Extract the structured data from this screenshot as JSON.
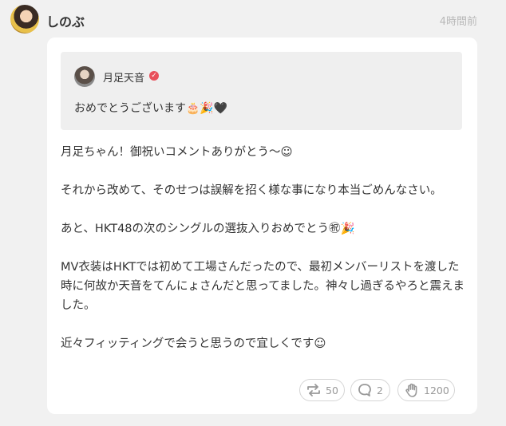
{
  "post": {
    "author": "しのぶ",
    "time": "4時間前",
    "quote": {
      "author": "月足天音",
      "verified_mark": "✓",
      "text": "おめでとうございます🎂🎉🖤"
    },
    "paragraphs": [
      "月足ちゃん！御祝いコメントありがとう〜☺",
      "それから改めて、そのせつは誤解を招く様な事になり本当ごめんなさい。",
      "あと、HKT48の次のシングルの選抜入りおめでとう㊗🎉",
      "MV衣装はHKTでは初めて工場さんだったので、最初メンバーリストを渡した時に何故か天音をてんにょさんだと思ってました。神々し過ぎるやろと震えました。",
      "近々フィッティングで会うと思うので宜しくです☺"
    ],
    "actions": {
      "repost": {
        "icon": "repost-icon",
        "count": "50"
      },
      "comment": {
        "icon": "comment-icon",
        "count": "2"
      },
      "clap": {
        "icon": "clap-icon",
        "count": "1200"
      }
    }
  },
  "colors": {
    "background": "#f1f1f1",
    "card": "#ffffff",
    "quote_bg": "#efefef",
    "verified": "#e8505b",
    "muted": "#999999"
  }
}
